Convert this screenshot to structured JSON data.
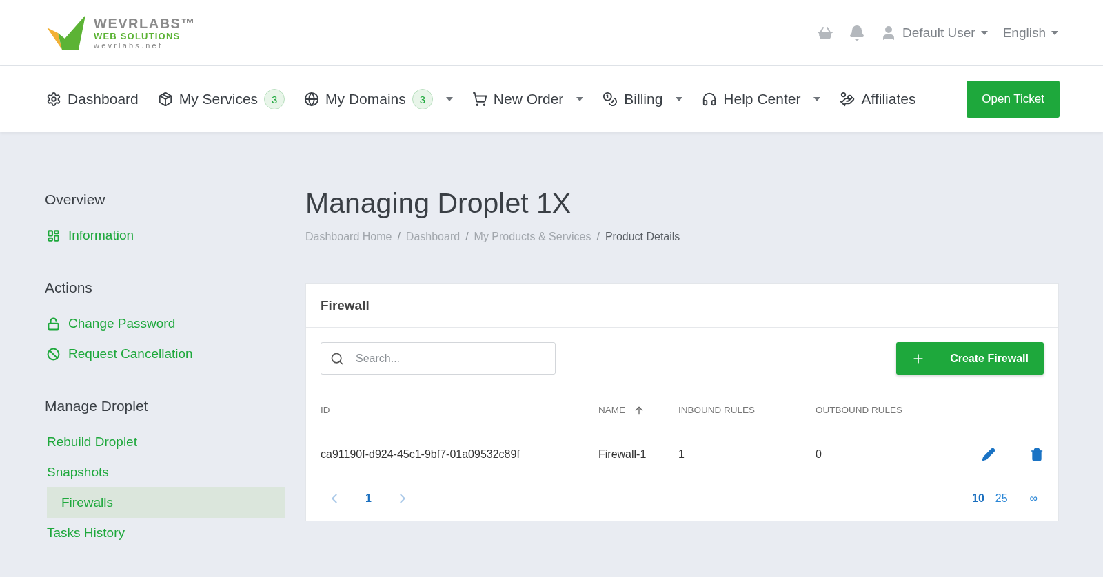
{
  "logo": {
    "name": "WEVRLABS",
    "trademark": "™",
    "tagline": "WEB SOLUTIONS",
    "site": "wevrlabs.net"
  },
  "top_bar": {
    "user": "Default User",
    "language": "English"
  },
  "nav": {
    "items": [
      {
        "kind": "dashboard",
        "label": "Dashboard",
        "dropdown": false
      },
      {
        "kind": "services",
        "label": "My Services",
        "badge": "3",
        "dropdown": false
      },
      {
        "kind": "domains",
        "label": "My Domains",
        "badge": "3",
        "dropdown": true
      },
      {
        "kind": "order",
        "label": "New Order",
        "dropdown": true
      },
      {
        "kind": "billing",
        "label": "Billing",
        "dropdown": true
      },
      {
        "kind": "help",
        "label": "Help Center",
        "dropdown": true
      },
      {
        "kind": "affiliates",
        "label": "Affiliates",
        "dropdown": false
      }
    ],
    "button": "Open Ticket"
  },
  "sidebar": {
    "sections": [
      {
        "title": "Overview",
        "items": [
          {
            "kind": "info",
            "label": "Information",
            "selected": false
          }
        ]
      },
      {
        "title": "Actions",
        "items": [
          {
            "kind": "password",
            "label": "Change Password",
            "selected": false
          },
          {
            "kind": "cancel",
            "label": "Request Cancellation",
            "selected": false
          }
        ]
      },
      {
        "title": "Manage Droplet",
        "items": [
          {
            "kind": "link",
            "label": "Rebuild Droplet",
            "selected": false
          },
          {
            "kind": "link",
            "label": "Snapshots",
            "selected": false
          },
          {
            "kind": "link",
            "label": "Firewalls",
            "selected": true
          },
          {
            "kind": "link",
            "label": "Tasks History",
            "selected": false
          }
        ]
      }
    ]
  },
  "page": {
    "title": "Managing Droplet 1X",
    "separator": "/",
    "breadcrumb": [
      {
        "label": "Dashboard Home",
        "current": false
      },
      {
        "label": "Dashboard",
        "current": false
      },
      {
        "label": "My Products & Services",
        "current": false
      },
      {
        "label": "Product Details",
        "current": true
      }
    ]
  },
  "card": {
    "title": "Firewall",
    "search": {
      "placeholder": "Search..."
    },
    "create_button": "Create Firewall",
    "table": {
      "columns": [
        {
          "label": "ID",
          "sorted": false
        },
        {
          "label": "NAME",
          "sorted": true
        },
        {
          "label": "INBOUND RULES",
          "sorted": false
        },
        {
          "label": "OUTBOUND RULES",
          "sorted": false
        }
      ],
      "rows": [
        {
          "cells": [
            "ca91190f-d924-45c1-9bf7-01a09532c89f",
            "Firewall-1",
            "1",
            "0"
          ]
        }
      ]
    },
    "pagination": {
      "prev_disabled": true,
      "next_disabled": true,
      "pages": [
        {
          "label": "1",
          "selected": true
        }
      ],
      "page_sizes": [
        {
          "label": "10",
          "selected": true
        },
        {
          "label": "25",
          "selected": false
        },
        {
          "label": "∞",
          "selected": false
        }
      ]
    }
  }
}
